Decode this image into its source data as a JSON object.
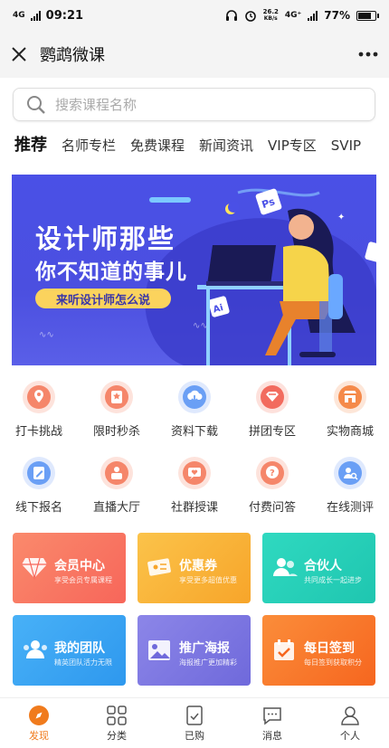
{
  "status_bar": {
    "network": "4G",
    "time": "09:21",
    "speed_value": "26.2",
    "speed_unit": "KB/s",
    "network2": "4G⁺",
    "battery": "77%"
  },
  "header": {
    "title": "鹦鹉微课"
  },
  "search": {
    "placeholder": "搜索课程名称"
  },
  "tabs": [
    "推荐",
    "名师专栏",
    "免费课程",
    "新闻资讯",
    "VIP专区",
    "SVIP"
  ],
  "banner": {
    "line1": "设计师那些",
    "line2": "你不知道的事儿",
    "tagline": "来听设计师怎么说"
  },
  "grid_row1": [
    {
      "label": "打卡挑战",
      "icon": "map-pin-icon",
      "color": "#f26b4e"
    },
    {
      "label": "限时秒杀",
      "icon": "flash-sale-icon",
      "color": "#f26b4e"
    },
    {
      "label": "资料下载",
      "icon": "cloud-download-icon",
      "color": "#4f8ef0"
    },
    {
      "label": "拼团专区",
      "icon": "group-buy-icon",
      "color": "#f25d4e"
    },
    {
      "label": "实物商城",
      "icon": "store-icon",
      "color": "#f07b3a"
    }
  ],
  "grid_row2": [
    {
      "label": "线下报名",
      "icon": "edit-icon",
      "color": "#4f8ef0"
    },
    {
      "label": "直播大厅",
      "icon": "live-camera-icon",
      "color": "#f26b4e"
    },
    {
      "label": "社群授课",
      "icon": "chat-heart-icon",
      "color": "#f26b4e"
    },
    {
      "label": "付费问答",
      "icon": "question-bubble-icon",
      "color": "#f26b4e"
    },
    {
      "label": "在线测评",
      "icon": "user-search-icon",
      "color": "#4f8ef0"
    }
  ],
  "cards": [
    {
      "title": "会员中心",
      "subtitle": "享受会员专属课程",
      "icon": "diamond-icon",
      "color_from": "#fa8a6c",
      "color_to": "#f7665a"
    },
    {
      "title": "优惠券",
      "subtitle": "享受更多超值优惠",
      "icon": "coupon-icon",
      "color_from": "#fbc34a",
      "color_to": "#f7a52a"
    },
    {
      "title": "合伙人",
      "subtitle": "共同成长一起进步",
      "icon": "partners-icon",
      "color_from": "#2fd9c0",
      "color_to": "#1fc6b0"
    },
    {
      "title": "我的团队",
      "subtitle": "精英团队活力无限",
      "icon": "team-icon",
      "color_from": "#48b1f7",
      "color_to": "#2e98ee"
    },
    {
      "title": "推广海报",
      "subtitle": "海报推广更加精彩",
      "icon": "image-icon",
      "color_from": "#8c86e8",
      "color_to": "#6f69db"
    },
    {
      "title": "每日签到",
      "subtitle": "每日签到获取积分",
      "icon": "calendar-check-icon",
      "color_from": "#fb8d3a",
      "color_to": "#f6661f"
    }
  ],
  "bottom_nav": [
    {
      "label": "发现",
      "icon": "compass-icon",
      "active": true
    },
    {
      "label": "分类",
      "icon": "grid-icon",
      "active": false
    },
    {
      "label": "已购",
      "icon": "purchased-icon",
      "active": false
    },
    {
      "label": "消息",
      "icon": "message-icon",
      "active": false
    },
    {
      "label": "个人",
      "icon": "profile-icon",
      "active": false
    }
  ],
  "colors": {
    "accent": "#f07b1d",
    "banner_bg": "#4a50e6"
  }
}
